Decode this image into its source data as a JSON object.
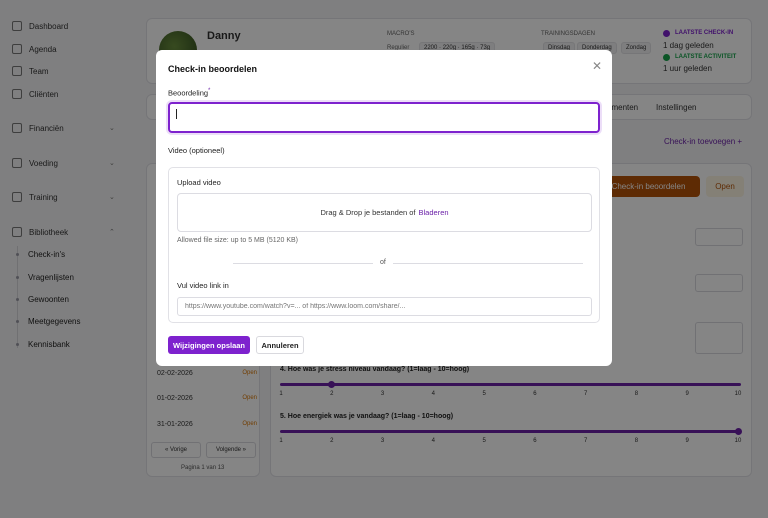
{
  "sidebar": {
    "items": [
      {
        "label": "Dashboard",
        "icon": "home-icon"
      },
      {
        "label": "Agenda",
        "icon": "calendar-icon"
      },
      {
        "label": "Team",
        "icon": "team-icon"
      },
      {
        "label": "Cliënten",
        "icon": "users-icon"
      },
      {
        "label": "Financiën",
        "icon": "finance-icon"
      },
      {
        "label": "Voeding",
        "icon": "food-icon"
      },
      {
        "label": "Training",
        "icon": "training-icon"
      },
      {
        "label": "Bibliotheek",
        "icon": "library-icon"
      }
    ],
    "library_sub": [
      "Check-in's",
      "Vragenlijsten",
      "Gewoonten",
      "Meetgegevens",
      "Kennisbank"
    ]
  },
  "client": {
    "name": "Danny",
    "macros_label": "MACRO'S",
    "macros_type": "Regulier",
    "macros_kcal": "2200",
    "macros_carbs": "220g",
    "macros_protein": "165g",
    "macros_fat": "73g",
    "training_label": "TRAININGSDAGEN",
    "training_days": [
      "Dinsdag",
      "Donderdag",
      "Zondag"
    ],
    "last_checkin_label": "LAATSTE CHECK-IN",
    "last_checkin_value": "1 dag geleden",
    "last_activity_label": "LAATSTE ACTIVITEIT",
    "last_activity_value": "1 uur geleden"
  },
  "tabs": {
    "partial": "ementen",
    "settings": "Instellingen"
  },
  "add_checkin": "Check-in toevoegen",
  "review_button": "Check-in beoordelen",
  "open_button": "Open",
  "checkin_list": {
    "rows": [
      {
        "date": "02-02-2026",
        "status": "Open"
      },
      {
        "date": "01-02-2026",
        "status": "Open"
      },
      {
        "date": "31-01-2026",
        "status": "Open"
      }
    ],
    "prev": "« Vorige",
    "next": "Volgende »",
    "page": "Pagina 1 van 13"
  },
  "questions": [
    {
      "label": "4. Hoe was je stress niveau vandaag? (1=laag - 10=hoog)",
      "value": 2
    },
    {
      "label": "5. Hoe energiek was je vandaag? (1=laag - 10=hoog)",
      "value": 10
    }
  ],
  "scale": [
    "1",
    "2",
    "3",
    "4",
    "5",
    "6",
    "7",
    "8",
    "9",
    "10"
  ],
  "modal": {
    "title": "Check-in beoordelen",
    "rating_label": "Beoordeling",
    "required_mark": "*",
    "video_label": "Video (optioneel)",
    "upload_title": "Upload video",
    "drop_text": "Drag & Drop je bestanden of",
    "browse": "Bladeren",
    "hint": "Allowed file size: up to 5 MB (5120 KB)",
    "or": "of",
    "link_label": "Vul video link in",
    "link_placeholder": "https://www.youtube.com/watch?v=... of https://www.loom.com/share/...",
    "save": "Wijzigingen opslaan",
    "cancel": "Annuleren"
  },
  "colors": {
    "primary": "#7e22ce",
    "accent_orange": "#b45309",
    "success": "#16a34a"
  }
}
